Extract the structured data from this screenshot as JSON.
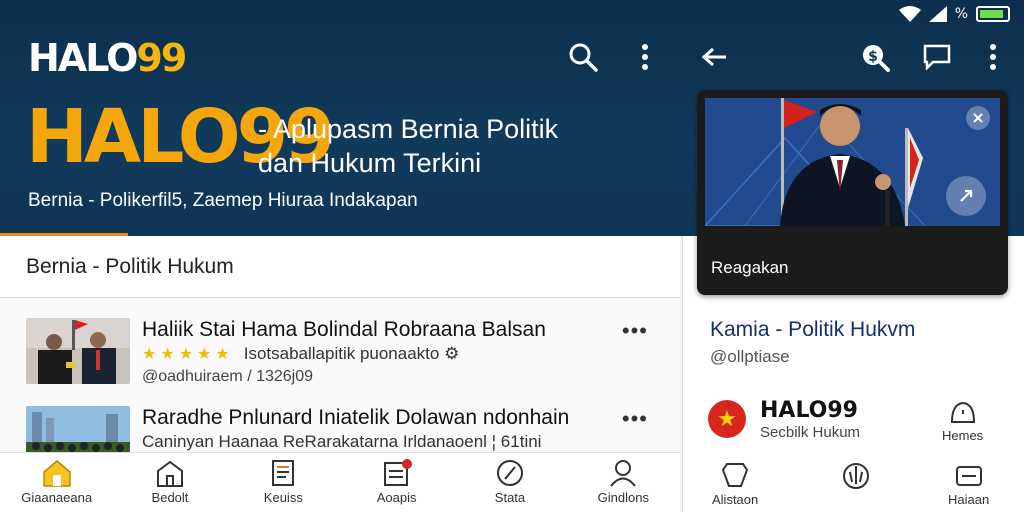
{
  "status_bar": {
    "battery_percent_label": "%",
    "battery_level": 0.9
  },
  "header": {
    "logo_text": "HALO",
    "logo_num": "99",
    "big_logo_text": "HALO",
    "big_logo_num": "99",
    "tagline_line1": "- Aplupasm Bernia Politik",
    "tagline_line2": "dan Hukum Terkini",
    "sub_tagline": "Bernia - Polikerfil5,  Zaemep   Hiuraa   Indakapan"
  },
  "section_title": "Bernia - Politik Hukum",
  "news": [
    {
      "title": "Haliik Stai Hama Bolindal Robraana Balsan",
      "stars": "★★★★★",
      "meta": "Isotsaballapitik puonaakto ⚙",
      "date": "@oadhuiraem  / 1326j09"
    },
    {
      "title": "Raradhe Pnlunard Iniatelik Dolawan ndonhain",
      "meta": "Caninyan Haanaa ReRarakatarna Irldanaoenl  ¦ 61tini"
    }
  ],
  "bottom_nav": [
    {
      "label": "Giaanaeana",
      "icon": "home-icon"
    },
    {
      "label": "Bedolt",
      "icon": "building-icon"
    },
    {
      "label": "Keuiss",
      "icon": "document-icon"
    },
    {
      "label": "Aoapis",
      "icon": "grid-icon"
    },
    {
      "label": "Stata",
      "icon": "stats-icon"
    },
    {
      "label": "Gindlons",
      "icon": "person-icon"
    }
  ],
  "video": {
    "caption": "Reagakan"
  },
  "right_panel": {
    "title": "Kamia - Politik Hukvm",
    "subtitle": "@ollptiase",
    "channel_name": "HALO99",
    "channel_category": "Secbilk Hukum",
    "items": [
      {
        "label": "Hemes",
        "icon": "alert-icon"
      },
      {
        "label": "Alistaon",
        "icon": "tag-icon"
      },
      {
        "label": "",
        "icon": "scale-icon"
      },
      {
        "label": "Haiaan",
        "icon": "card-icon"
      }
    ]
  },
  "colors": {
    "header_bg": "#0f3556",
    "accent": "#f5a60a",
    "orange_line": "#f08a1c",
    "star": "#f2b90f"
  }
}
